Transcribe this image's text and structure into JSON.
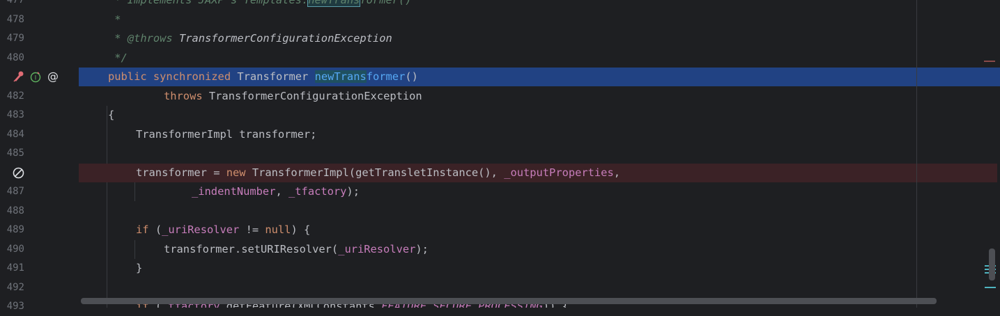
{
  "gutter": {
    "line_numbers": [
      "477",
      "478",
      "479",
      "480",
      "",
      "482",
      "483",
      "484",
      "485",
      "",
      "487",
      "488",
      "489",
      "490",
      "491",
      "492",
      "493"
    ]
  },
  "code": {
    "l477": {
      "star": " * Implements JAXP's Templates.",
      "hl": "newTrans",
      "rest": "former()"
    },
    "l478": " *",
    "l479": {
      "star": " * ",
      "tag": "@throws",
      "cls": " TransformerConfigurationException"
    },
    "l480": " */",
    "l481": {
      "k1": "public",
      "k2": "synchronized",
      "t1": "Transformer",
      "m1": "newTrans",
      "m2": "former",
      "rest": "()"
    },
    "l482": {
      "k": "throws",
      "t": "TransformerConfigurationException"
    },
    "l483": "{",
    "l484": "TransformerImpl transformer;",
    "l486": {
      "a": "transformer = ",
      "k": "new",
      "b": " TransformerImpl(getTransletInstance(), ",
      "f": "_outputProperties",
      "c": ","
    },
    "l487": {
      "f1": "_indentNumber",
      "s": ", ",
      "f2": "_tfactory",
      "e": ");"
    },
    "l489": {
      "k1": "if",
      "a": " (",
      "f": "_uriResolver",
      "b": " != ",
      "k2": "null",
      "c": ") {"
    },
    "l490": {
      "a": "transformer.setURIResolver(",
      "f": "_uriResolver",
      "b": ");"
    },
    "l491": "}",
    "l493": {
      "k": "if",
      "a": " (",
      "f": "_tfactory",
      "b": ".getFeature(XMLConstants.",
      "c": "FEATURE_SECURE_PROCESSING",
      "d": ")) {"
    }
  },
  "colors": {
    "background": "#1e1f22",
    "selection": "#214283",
    "breakpoint_line": "#3b2226",
    "keyword": "#cf8e6d",
    "field": "#c77dbb",
    "method": "#56a8f5",
    "comment": "#5f826b"
  }
}
